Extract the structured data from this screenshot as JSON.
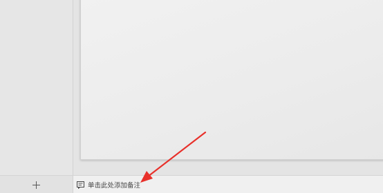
{
  "notes": {
    "placeholder": "单击此处添加备注",
    "icon": "note-icon"
  },
  "add_slide": {
    "icon": "plus-icon"
  },
  "annotation": {
    "arrow_color": "#e8302a"
  }
}
